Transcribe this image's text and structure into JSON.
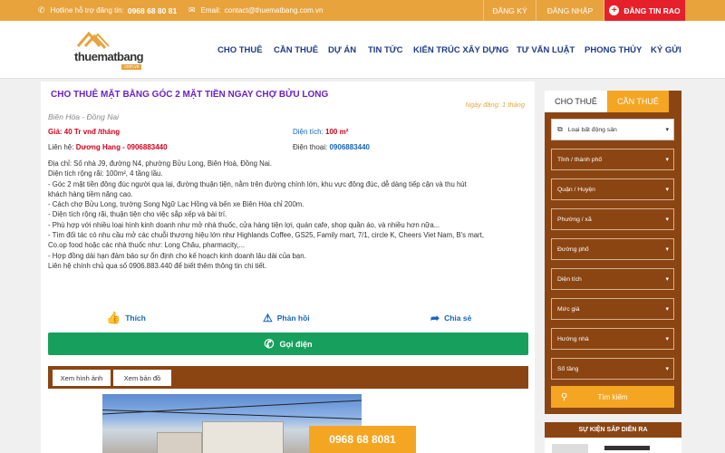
{
  "topbar": {
    "hotline_label": "Hotline hỗ trợ đăng tin:",
    "hotline_number": "0968 68 80 81",
    "email_label": "Email:",
    "email": "contact@thuematbang.com.vn",
    "register": "ĐĂNG KÝ",
    "login": "ĐĂNG NHẬP",
    "post": "ĐĂNG TIN RAO",
    "brand_color": "#e8a33d",
    "post_color": "#e6202b"
  },
  "logo": {
    "name": "thuematbang",
    "sub": ".com.vn"
  },
  "nav": [
    "CHO THUÊ",
    "CẦN THUÊ",
    "DỰ ÁN",
    "TIN TỨC",
    "KIẾN TRÚC XÂY DỰNG",
    "TƯ VẤN LUẬT",
    "PHONG THỦY",
    "KÝ GỬI"
  ],
  "listing": {
    "title": "CHO THUÊ MẶT BẰNG GÓC 2 MẶT TIỀN NGAY CHỢ BỬU LONG",
    "posted": "Ngày đăng: 1 tháng",
    "location": "Biên Hòa - Đồng Nai",
    "price_label": "Giá:",
    "price_value": "40 Tr vnđ /tháng",
    "area_label": "Diện tích:",
    "area_value": "100 m²",
    "contact_label": "Liên hệ:",
    "contact_value": "Dương Hang - 0906883440",
    "phone_label": "Điện thoại:",
    "phone_value": "0906883440",
    "description": [
      "Địa chỉ: Số nhà J9, đường N4, phường Bửu Long, Biên Hoà, Đồng Nai.",
      "Diện tích rộng rãi: 100m², 4 tầng lầu.",
      "- Góc 2 mặt tiền đông đúc người qua lại, đường thuận tiện, nằm trên đường chính lớn, khu vực đông đúc, dễ dàng tiếp cận và thu hút",
      "khách hàng tiềm năng cao.",
      "- Cách chợ Bửu Long, trường Song Ngữ Lạc Hồng và bến xe Biên Hòa chỉ 200m.",
      "- Diện tích rộng rãi, thuận tiện cho việc sắp xếp và bài trí.",
      "- Phù hợp với nhiều loại hình kinh doanh như mở nhà thuốc, cửa hàng tiện lợi, quán cafe, shop quần áo, và nhiều hơn nữa...",
      "- Tìm đối tác có nhu cầu mở các chuỗi thương hiệu lớn như Highlands Coffee, GS25, Family mart, 7/1, circle K, Cheers Viet Nam, B's mart,",
      "Co.op food hoặc các nhà thuốc như: Long Châu, pharmacity,...",
      "- Hợp đồng dài hạn đảm bảo sự ổn định cho kế hoạch kinh doanh lâu dài của bạn.",
      "Liên hệ chính chủ qua số 0906.883.440 để biết thêm thông tin chi tiết."
    ],
    "like": "Thích",
    "report": "Phản hồi",
    "share": "Chia sẻ",
    "call": "Gọi điện",
    "tab_images": "Xem hình ảnh",
    "tab_map": "Xem bản đồ",
    "photo_phone": "0968 68 8081"
  },
  "sidebar": {
    "tab_rent": "CHO THUÊ",
    "tab_need": "CẦN THUÊ",
    "selects": [
      "Loại bất động sản",
      "Tỉnh / thành phố",
      "Quận / Huyện",
      "Phường / xã",
      "Đường phố",
      "Diện tích",
      "Mức giá",
      "Hướng nhà",
      "Số tầng"
    ],
    "search": "Tìm kiếm",
    "events_title": "SỰ KIỆN SẮP DIỄN RA"
  }
}
